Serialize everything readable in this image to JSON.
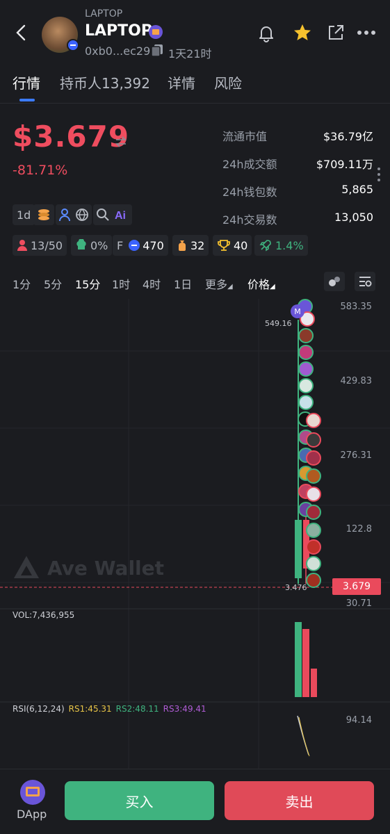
{
  "header": {
    "token_small": "LAPTOP",
    "token_name": "LAPTOP",
    "address": "0xb0...ec29",
    "age": "1天21时",
    "icons": [
      "back-icon",
      "bell-icon",
      "star-icon",
      "share-icon",
      "more-icon",
      "copy-icon"
    ],
    "accent_star": "#f5c12e"
  },
  "tabs": [
    {
      "label": "行情"
    },
    {
      "label": "持币人13,392"
    },
    {
      "label": "详情"
    },
    {
      "label": "风险"
    }
  ],
  "price": {
    "value": "$3.679",
    "change": "-81.71%",
    "color": "#ef4d5f"
  },
  "stats": [
    {
      "label": "流通市值",
      "value": "$36.79亿"
    },
    {
      "label": "24h成交额",
      "value": "$709.11万"
    },
    {
      "label": "24h钱包数",
      "value": "5,865"
    },
    {
      "label": "24h交易数",
      "value": "13,050"
    }
  ],
  "tags": {
    "age_chip": "1d"
  },
  "chips": [
    {
      "icon": "holder-icon",
      "text": "13/50"
    },
    {
      "icon": "chef-icon",
      "text": "0%"
    },
    {
      "icon": "f-icon",
      "prefix": "F",
      "text": "470"
    },
    {
      "icon": "money-bag-icon",
      "text": "32"
    },
    {
      "icon": "trophy-icon",
      "text": "40"
    },
    {
      "icon": "rocket-icon",
      "text": "1.4%"
    }
  ],
  "timeframes": [
    "1分",
    "5分",
    "15分",
    "1时",
    "4时",
    "1日",
    "更多",
    "价格"
  ],
  "active_timeframe": "15分",
  "chart": {
    "axis": [
      "583.35",
      "429.83",
      "276.31",
      "122.8",
      "30.71"
    ],
    "high_label": "549.16",
    "low_label": "3.476",
    "current_price": "3.679",
    "marker": "M",
    "watermark": "Ave Wallet"
  },
  "volume": {
    "label": "VOL:7,436,955"
  },
  "rsi": {
    "label": "RSI(6,12,24)",
    "rs1": "RS1:45.31",
    "rs2": "RS2:48.11",
    "rs3": "RS3:49.41",
    "axis": "94.14",
    "colors": {
      "rs1": "#e8c547",
      "rs2": "#3fb37f",
      "rs3": "#b05cd6"
    }
  },
  "bottom": {
    "dapp": "DApp",
    "buy": "买入",
    "sell": "卖出",
    "buy_color": "#3fb37f",
    "sell_color": "#e04a58"
  }
}
